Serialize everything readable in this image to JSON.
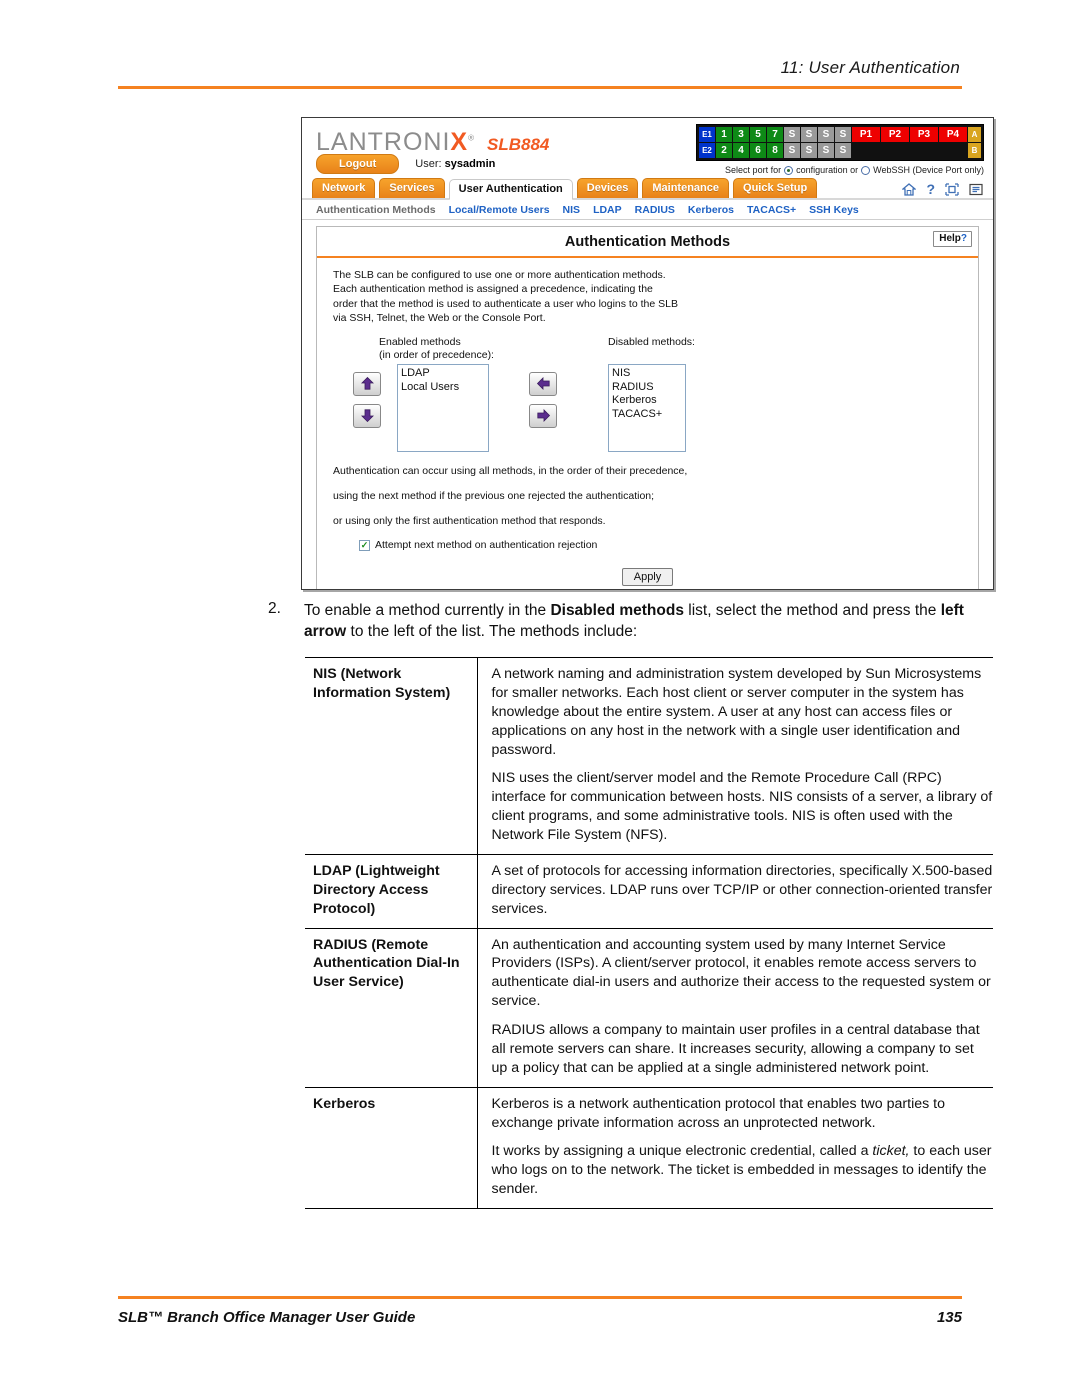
{
  "page": {
    "header_title": "11: User Authentication",
    "footer_left": "SLB™ Branch Office Manager User Guide",
    "footer_page": "135"
  },
  "app": {
    "brand": {
      "logo_left": "LANTRONI",
      "logo_x": "X",
      "logo_reg": "®",
      "model": "SLB884"
    },
    "ports": {
      "row1": [
        "E1",
        "1",
        "3",
        "5",
        "7",
        "S",
        "S",
        "S",
        "S",
        "P1",
        "P2",
        "P3",
        "P4",
        "A"
      ],
      "row2": [
        "E2",
        "2",
        "4",
        "6",
        "8",
        "S",
        "S",
        "S",
        "S",
        "B"
      ],
      "caption_prefix": "Select port for",
      "option_config": "configuration or",
      "option_webssh": "WebSSH (Device Port only)"
    },
    "userbar": {
      "logout_label": "Logout",
      "user_prefix": "User:",
      "user_name": "sysadmin"
    },
    "tabs": [
      {
        "label": "Network",
        "active": false
      },
      {
        "label": "Services",
        "active": false
      },
      {
        "label": "User Authentication",
        "active": true
      },
      {
        "label": "Devices",
        "active": false
      },
      {
        "label": "Maintenance",
        "active": false
      },
      {
        "label": "Quick Setup",
        "active": false
      }
    ],
    "tool_icons": [
      "home-icon",
      "help-question-icon",
      "expand-icon",
      "log-list-icon"
    ],
    "subnav": [
      {
        "label": "Authentication Methods",
        "current": true
      },
      {
        "label": "Local/Remote Users",
        "current": false
      },
      {
        "label": "NIS",
        "current": false
      },
      {
        "label": "LDAP",
        "current": false
      },
      {
        "label": "RADIUS",
        "current": false
      },
      {
        "label": "Kerberos",
        "current": false
      },
      {
        "label": "TACACS+",
        "current": false
      },
      {
        "label": "SSH Keys",
        "current": false
      }
    ],
    "panel": {
      "title": "Authentication Methods",
      "help_label": "Help",
      "help_mark": "?",
      "intro_line1": "The SLB can be configured to use one or more authentication methods.",
      "intro_line2": "Each authentication method is assigned a precedence, indicating the",
      "intro_line3": "order that the method is used to authenticate a user who logins to the SLB",
      "intro_line4": "via SSH, Telnet, the Web or the Console Port.",
      "enabled_label_line1": "Enabled methods",
      "enabled_label_line2": "(in order of precedence):",
      "disabled_label": "Disabled methods:",
      "enabled_items": [
        "LDAP",
        "Local Users"
      ],
      "disabled_items": [
        "NIS",
        "RADIUS",
        "Kerberos",
        "TACACS+"
      ],
      "note_line1": "Authentication can occur using all methods, in the order of their precedence,",
      "note_line2": "using the next method if the previous one rejected the authentication;",
      "note_line3": "or using only the first authentication method that responds.",
      "checkbox_label": "Attempt next method on authentication rejection",
      "checkbox_checked": true,
      "check_glyph": "✓",
      "apply_label": "Apply"
    }
  },
  "step": {
    "number": "2.",
    "part1": "To enable a method currently in the ",
    "bold1": "Disabled methods",
    "part2": " list, select the method and press the ",
    "bold2": "left arrow",
    "part3": " to the left of the list. The methods include:"
  },
  "definitions": [
    {
      "term": "NIS (Network Information System)",
      "paragraphs": [
        "A network naming and administration system developed by Sun Microsystems for smaller networks. Each host client or server computer in the system has knowledge about the entire system. A user at any host can access files or applications on any host in the network with a single user identification and password.",
        "NIS uses the client/server model and the Remote Procedure Call (RPC) interface for communication between hosts. NIS consists of a server, a library of client programs, and some administrative tools. NIS is often used with the Network File System (NFS)."
      ]
    },
    {
      "term": "LDAP (Lightweight Directory Access Protocol)",
      "paragraphs": [
        "A set of protocols for accessing information directories, specifically X.500-based directory services. LDAP runs over TCP/IP or other connection-oriented transfer services."
      ]
    },
    {
      "term": "RADIUS (Remote Authentication Dial-In User Service)",
      "paragraphs": [
        "An authentication and accounting system used by many Internet Service Providers (ISPs). A client/server protocol, it enables remote access servers to authenticate dial-in users and authorize their access to the requested system or service.",
        "RADIUS allows a company to maintain user profiles in a central database that all remote servers can share. It increases security, allowing a company to set up a policy that can be applied at a single administered network point."
      ]
    },
    {
      "term": "Kerberos",
      "paragraphs": [
        "Kerberos is a network authentication protocol that enables two parties to exchange private information across an unprotected network.",
        "It works by assigning a unique electronic credential, called a {i}ticket,{/i} to each user who logs on to the network. The ticket is embedded in messages to identify the sender."
      ]
    }
  ],
  "colors": {
    "accent_orange": "#F58220",
    "logo_orange": "#F15A22",
    "link_blue": "#1f62c4",
    "arrow_purple": "#5B2D8E"
  }
}
